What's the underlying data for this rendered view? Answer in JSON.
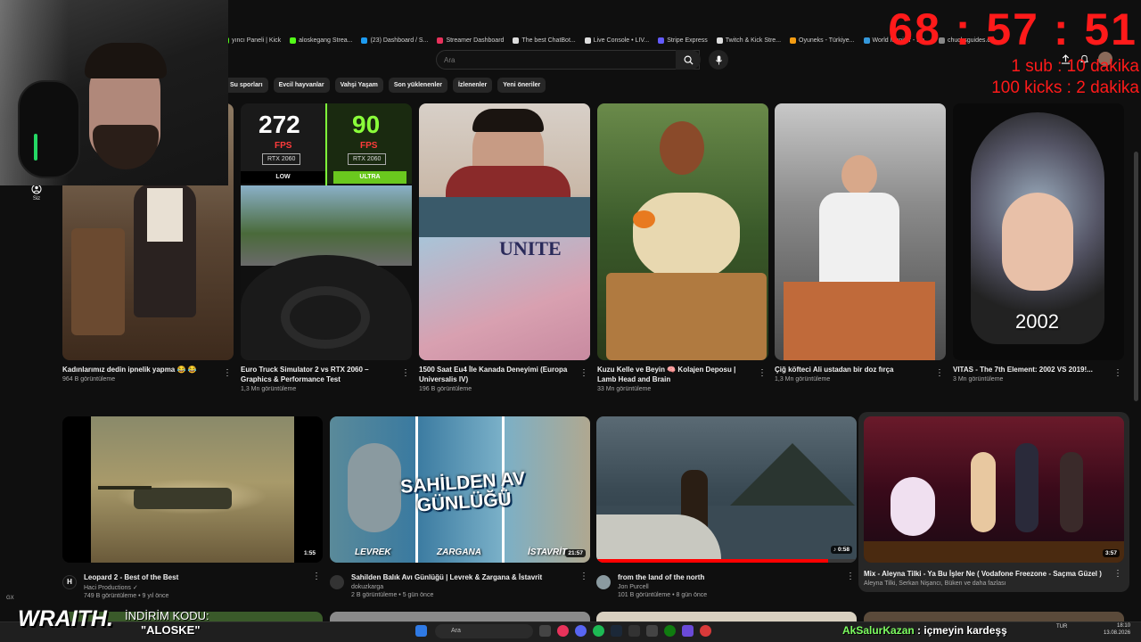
{
  "bookmarks": [
    "yıncı Paneli | Kick",
    "aloskegang Strea...",
    "(23) Dashboard / S...",
    "Streamer Dashboard",
    "The best ChatBot...",
    "Live Console • LIV...",
    "Stripe Express",
    "Twitch & Kick Stre...",
    "Oyuneks - Türkiye...",
    "World Monitor - Re...",
    "chucksguides.c..."
  ],
  "search": {
    "placeholder": "Ara"
  },
  "chips": [
    "Su sporları",
    "Evcil hayvanlar",
    "Vahşi Yaşam",
    "Son yüklenenler",
    "İzlenenler",
    "Yeni öneriler"
  ],
  "overlay": {
    "timer": "68 : 57 : 51",
    "sub_rule": "1 sub : 10 dakika",
    "kick_rule": "100 kicks : 2 dakika"
  },
  "leftnav": {
    "you_label": "Siz"
  },
  "row1": [
    {
      "title": "Kadınlarımız dedin ipnelik yapma 😂 😂",
      "meta": "964 B görüntüleme"
    },
    {
      "title": "Euro Truck Simulator 2 vs RTX 2060 – Graphics & Performance Test",
      "meta": "1,3 Mn görüntüleme",
      "fps_left": "272",
      "fps_right": "90",
      "fps_unit": "FPS",
      "gpu": "RTX 2060",
      "low": "LOW",
      "ultra": "ULTRA"
    },
    {
      "title": "1500 Saat Eu4 İle Kanada Deneyimi (Europa Universalis IV)",
      "meta": "196 B görüntüleme"
    },
    {
      "title": "Kuzu Kelle ve Beyin 🧠 Kolajen Deposu | Lamb Head and Brain",
      "meta": "33 Mn görüntüleme"
    },
    {
      "title": "Çiğ köfteci Ali ustadan bir doz fırça",
      "meta": "1,3 Mn görüntüleme"
    },
    {
      "title": "VITAS - The 7th Element: 2002 VS 2019!...",
      "meta": "3 Mn görüntüleme",
      "thumb_text": "2002"
    }
  ],
  "row2": [
    {
      "title": "Leopard 2 - Best of the Best",
      "channel": "Haci Productions ✓",
      "meta": "749 B görüntüleme • 9 yıl önce",
      "duration": "1:55"
    },
    {
      "title": "Sahilden Balık Avı Günlüğü | Levrek & Zargana & İstavrit",
      "channel": "dokuzkarga",
      "meta": "2 B görüntüleme • 5 gün önce",
      "duration": "21:57",
      "thumb_title": "SAHİLDEN AV GÜNLÜĞÜ",
      "fish": [
        "LEVREK",
        "ZARGANA",
        "İSTAVRİT"
      ]
    },
    {
      "title": "from the land of the north",
      "channel": "Jon Purcell",
      "meta": "101 B görüntüleme • 8 gün önce",
      "duration": "♪ 0:58"
    },
    {
      "title": "Mix - Aleyna Tilki - Ya Bu İşler Ne ( Vodafone Freezone - Saçma Güzel )",
      "channel": "Aleyna Tilki, Serkan Nişancı, Büken ve daha fazlası",
      "meta": "",
      "duration": "3:57"
    }
  ],
  "stream_overlay": {
    "brand": "WRAITH.",
    "discount_label": "İNDİRİM KODU:",
    "code": "\"ALOSKE\"",
    "chat_user": "AkSalurKazan",
    "chat_message": ": içmeyin kardeşş"
  },
  "taskbar": {
    "search": "Ara",
    "lang": "TUR",
    "time": "18:10",
    "date": "13.08.2026"
  },
  "browser": {
    "gx": "GX"
  }
}
